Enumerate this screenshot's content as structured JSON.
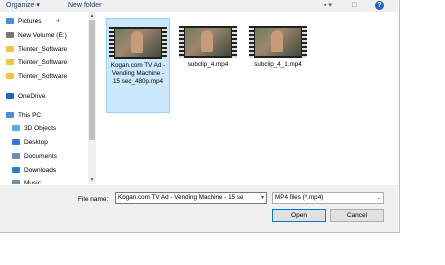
{
  "toolbar": {
    "organize": "Organize ▾",
    "new_folder": "New folder",
    "view_icon": "▪ ▾",
    "pane_icon": "□",
    "help": "?"
  },
  "nav": [
    {
      "label": "Pictures",
      "icon": "pictures",
      "color": "#4a8fd8",
      "pin": "✈"
    },
    {
      "label": "New Volume (E:)",
      "icon": "drive",
      "color": "#777777"
    },
    {
      "label": "Tkinter_Software",
      "icon": "folder",
      "color": "#f5c542"
    },
    {
      "label": "Tkinter_Software",
      "icon": "folder",
      "color": "#f5c542"
    },
    {
      "label": "Tkinter_Software",
      "icon": "folder",
      "color": "#f5c542"
    },
    {
      "label": "OneDrive",
      "icon": "cloud",
      "color": "#1e66c6"
    },
    {
      "label": "This PC",
      "icon": "computer",
      "color": "#4a8fd8"
    },
    {
      "label": "3D Objects",
      "icon": "cube",
      "color": "#4fb3e8"
    },
    {
      "label": "Desktop",
      "icon": "desktop",
      "color": "#2b7bd6"
    },
    {
      "label": "Documents",
      "icon": "documents",
      "color": "#6b8fb8"
    },
    {
      "label": "Downloads",
      "icon": "downloads",
      "color": "#2b7bd6"
    },
    {
      "label": "Music",
      "icon": "music",
      "color": "#6b8fb8"
    }
  ],
  "files": [
    {
      "name": "Kogan.com TV Ad - Vending Machine - 15 sec_480p.mp4",
      "selected": true
    },
    {
      "name": "subclip_4.mp4",
      "selected": false
    },
    {
      "name": "subclip_4_1.mp4",
      "selected": false
    }
  ],
  "bottom": {
    "file_name_label": "File name:",
    "file_name_value": "Kogan.com TV Ad - Vending Machine - 15 se",
    "file_type": "MP4 files (*.mp4)",
    "open_label": "Open",
    "cancel_label": "Cancel"
  }
}
